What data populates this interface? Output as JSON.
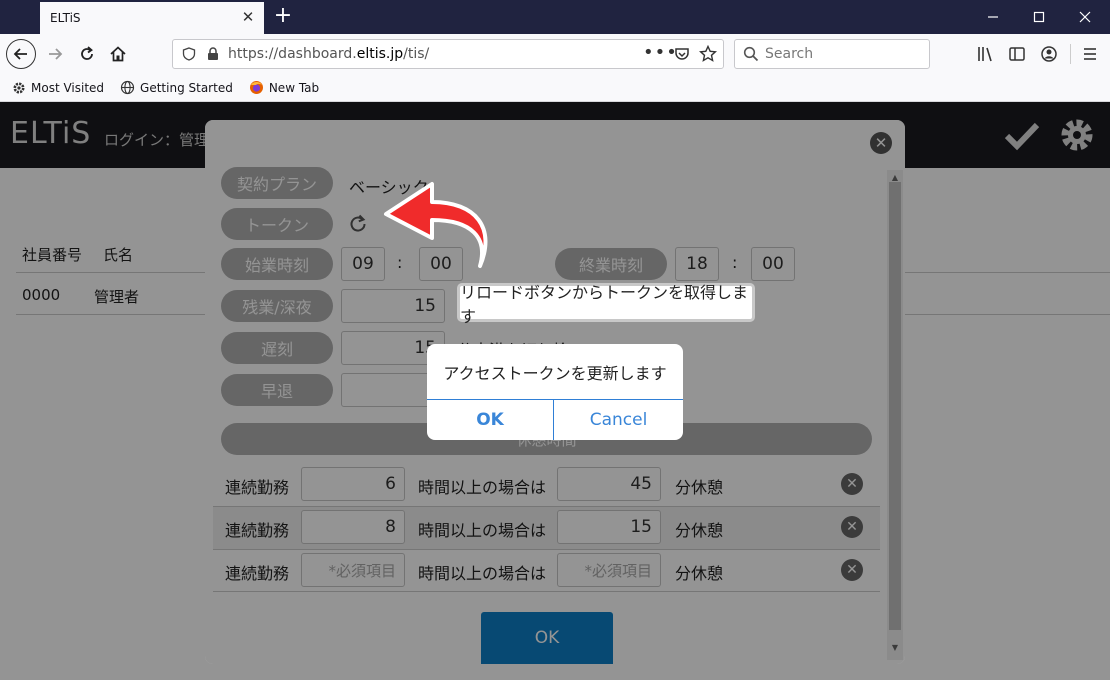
{
  "browser": {
    "tab_title": "ELTiS",
    "url_prefix": "https://dashboard.",
    "url_domain": "eltis.jp",
    "url_suffix": "/tis/",
    "search_placeholder": "Search",
    "bookmarks": [
      "Most Visited",
      "Getting Started",
      "New Tab"
    ]
  },
  "app": {
    "logo": "ELTiS",
    "login_label": "ログイン：管理",
    "table_headers": [
      "社員番号",
      "氏名"
    ],
    "rows": [
      {
        "id": "0000",
        "name": "管理者"
      }
    ]
  },
  "modal": {
    "plan_label": "契約プラン",
    "plan_value": "ベーシック",
    "token_label": "トークン",
    "start_label": "始業時刻",
    "start_hour": "09",
    "start_min": "00",
    "end_label": "終業時刻",
    "end_hour": "18",
    "end_min": "00",
    "colon": ":",
    "overtime_label": "残業/深夜",
    "overtime_value": "15",
    "late_label": "遅刻",
    "late_value": "15",
    "late_note": "分未満を切り捨て",
    "early_label": "早退",
    "early_value": "1",
    "break_header": "休憩時間",
    "break_rows": [
      {
        "prefix": "連続勤務",
        "hours": "6",
        "middle": "時間以上の場合は",
        "minutes": "45",
        "suffix": "分休憩"
      },
      {
        "prefix": "連続勤務",
        "hours": "8",
        "middle": "時間以上の場合は",
        "minutes": "15",
        "suffix": "分休憩"
      },
      {
        "prefix": "連続勤務",
        "hours_placeholder": "*必須項目",
        "middle": "時間以上の場合は",
        "minutes_placeholder": "*必須項目",
        "suffix": "分休憩"
      }
    ],
    "ok_label": "OK"
  },
  "tooltip": "リロードボタンからトークンを取得します",
  "confirm": {
    "message": "アクセストークンを更新します",
    "ok": "OK",
    "cancel": "Cancel"
  }
}
